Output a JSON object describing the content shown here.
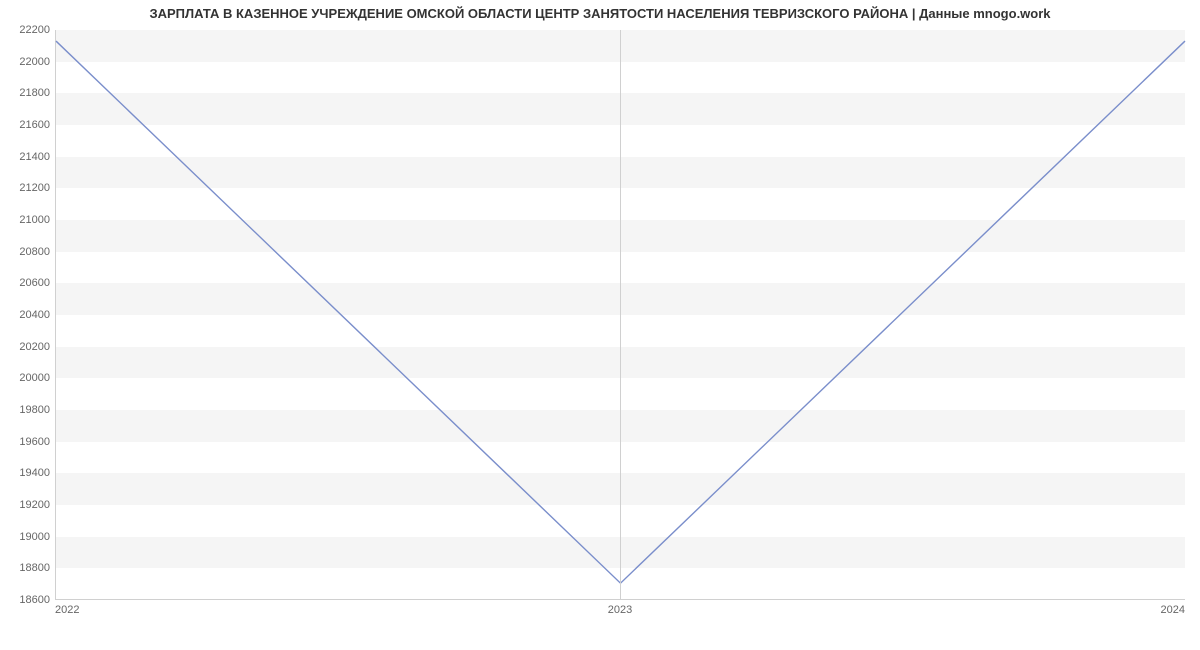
{
  "chart_data": {
    "type": "line",
    "title": "ЗАРПЛАТА В КАЗЕННОЕ УЧРЕЖДЕНИЕ ОМСКОЙ ОБЛАСТИ ЦЕНТР ЗАНЯТОСТИ НАСЕЛЕНИЯ ТЕВРИЗСКОГО РАЙОНА | Данные mnogo.work",
    "xlabel": "",
    "ylabel": "",
    "x": [
      "2022",
      "2023",
      "2024"
    ],
    "values": [
      22130,
      18700,
      22130
    ],
    "ylim": [
      18600,
      22200
    ],
    "yticks": [
      18600,
      18800,
      19000,
      19200,
      19400,
      19600,
      19800,
      20000,
      20200,
      20400,
      20600,
      20800,
      21000,
      21200,
      21400,
      21600,
      21800,
      22000,
      22200
    ],
    "xtick_labels": [
      "2022",
      "2023",
      "2024"
    ],
    "line_color": "#7a8ecb"
  }
}
